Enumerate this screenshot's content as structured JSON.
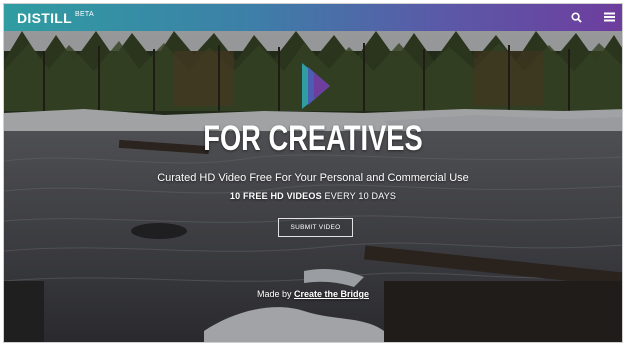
{
  "header": {
    "logo_text": "DISTILL",
    "logo_badge": "BETA",
    "search_icon": "search-icon",
    "menu_icon": "hamburger-menu-icon"
  },
  "hero": {
    "emblem_icon": "play-triangle-logo-icon",
    "headline": "FOR CREATIVES",
    "subline": "Curated HD Video Free For Your Personal and Commercial Use",
    "tagline_bold": "10 FREE HD VIDEOS",
    "tagline_rest": " EVERY 10 DAYS",
    "submit_label": "SUBMIT VIDEO",
    "madeby_prefix": "Made by ",
    "madeby_link": "Create the Bridge"
  },
  "colors": {
    "header_gradient_start": "#2f9da1",
    "header_gradient_end": "#6e3d9e",
    "text": "#ffffff"
  }
}
